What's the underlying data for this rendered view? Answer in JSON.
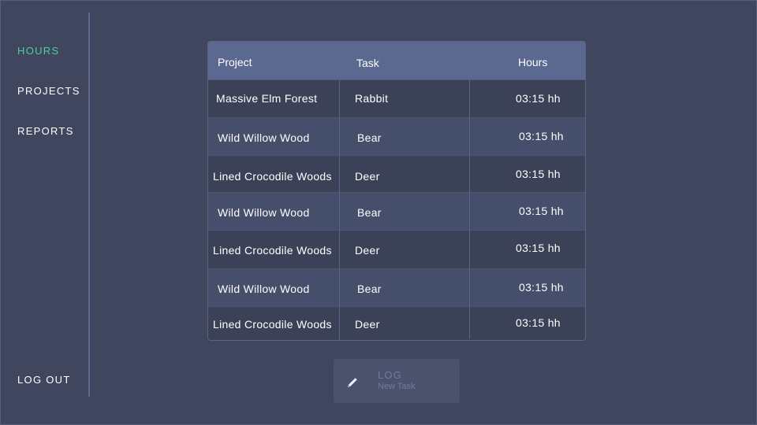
{
  "sidebar": {
    "items": [
      {
        "label": "HOURS",
        "active": true
      },
      {
        "label": "PROJECTS",
        "active": false
      },
      {
        "label": "REPORTS",
        "active": false
      }
    ],
    "logout_label": "LOG OUT"
  },
  "table": {
    "headers": {
      "project": "Project",
      "task": "Task",
      "hours": "Hours"
    },
    "rows": [
      {
        "project": "Massive Elm Forest",
        "task": "Rabbit",
        "hours": "03:15 hh"
      },
      {
        "project": "Wild Willow Wood",
        "task": "Bear",
        "hours": "03:15 hh"
      },
      {
        "project": "Lined Crocodile Woods",
        "task": "Deer",
        "hours": "03:15 hh"
      },
      {
        "project": "Wild Willow Wood",
        "task": "Bear",
        "hours": "03:15 hh"
      },
      {
        "project": "Lined Crocodile Woods",
        "task": "Deer",
        "hours": "03:15 hh"
      },
      {
        "project": "Wild Willow Wood",
        "task": "Bear",
        "hours": "03:15 hh"
      },
      {
        "project": "Lined Crocodile Woods",
        "task": "Deer",
        "hours": "03:15 hh"
      }
    ]
  },
  "log_button": {
    "label": "LOG",
    "sublabel": "New Task",
    "icon": "pencil-icon"
  },
  "colors": {
    "background": "#3f465e",
    "accent": "#4ecf9b",
    "header": "#5b6890",
    "button_text": "#6c7ba6"
  }
}
